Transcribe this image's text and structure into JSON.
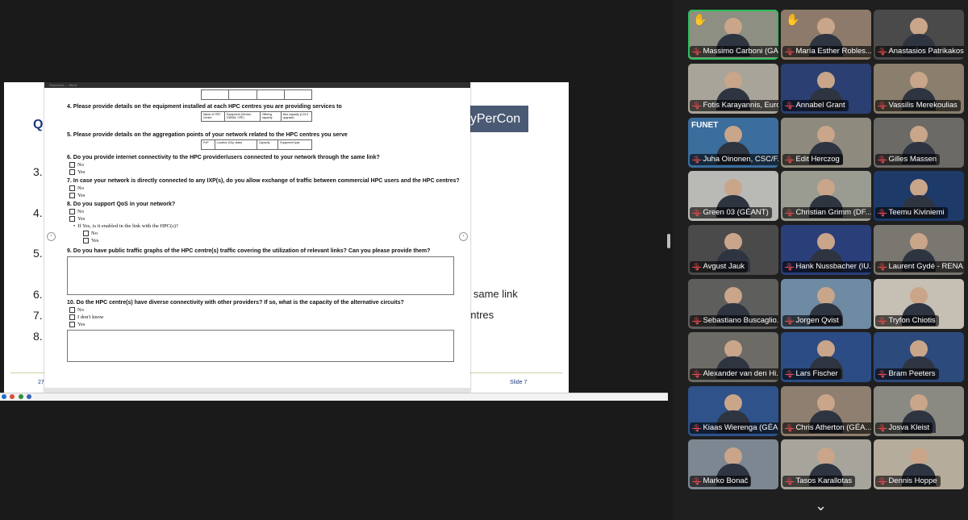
{
  "slide": {
    "heading_letter": "Q",
    "badge": "yPerCon",
    "left_numbers": [
      "3.",
      "4.",
      "5.",
      "6.",
      "7.",
      "8."
    ],
    "right_fragments": [
      "e same link",
      "entres"
    ],
    "footer_left": "27",
    "footer_right": "Slide 7"
  },
  "document": {
    "title_bar": "Document — Word",
    "q4": "4. Please provide details on the equipment installed at each HPC centres you are providing services to",
    "q4_table_headers": [
      "Name of HPC Centre",
      "Equipment (Vendor, DWDM, CPE)",
      "Offering capacity",
      "Max capacity (L2/L3 upgrade)"
    ],
    "q5": "5. Please provide details on the aggregation points of your network related to the HPC centres you serve",
    "q5_table_headers": [
      "PoP",
      "Location (City, state)",
      "Capacity",
      "Equipment type"
    ],
    "q6": "6. Do you provide internet connectivity to the HPC provider/users connected to your network through the same link?",
    "q6_options": [
      "No",
      "Yes"
    ],
    "q7": "7. In case your network is directly connected to any IXP(s), do you allow exchange of traffic between commercial HPC users and the HPC centres?",
    "q7_options": [
      "No",
      "Yes"
    ],
    "q8": "8. Do you support QoS in your network?",
    "q8_options": [
      "No",
      "Yes"
    ],
    "q8_sub": "If Yes, is it enabled in the link with the HPC(s)?",
    "q8_sub_options": [
      "No",
      "Yes"
    ],
    "q9": "9. Do you have public traffic graphs of the HPC centre(s) traffic covering the utilization of relevant links? Can you please provide them?",
    "q10": "10. Do the HPC centre(s) have diverse connectivity with other providers? If so, what is the capacity of the alternative circuits?",
    "q10_options": [
      "No",
      "I don't know",
      "Yes"
    ]
  },
  "participants": [
    {
      "name": "Massimo Carboni (GARR)",
      "raised_hand": true,
      "active": true,
      "bg": "#8c8f82"
    },
    {
      "name": "María Esther Robles...",
      "raised_hand": true,
      "active": false,
      "bg": "#8d7a6a"
    },
    {
      "name": "Anastasios Patrikakos",
      "raised_hand": false,
      "active": false,
      "bg": "#4a4a4a"
    },
    {
      "name": "Fotis Karayannis, EuroH...",
      "raised_hand": false,
      "active": false,
      "bg": "#a9a49a"
    },
    {
      "name": "Annabel Grant",
      "raised_hand": false,
      "active": false,
      "bg": "#2b3f73"
    },
    {
      "name": "Vassilis Merekoulias",
      "raised_hand": false,
      "active": false,
      "bg": "#8a7e6c"
    },
    {
      "name": "Juha Oinonen, CSC/F...",
      "raised_hand": false,
      "active": false,
      "bg": "#3b6d9d",
      "brand": "FUNET"
    },
    {
      "name": "Edit Herczog",
      "raised_hand": false,
      "active": false,
      "bg": "#8e8a7d"
    },
    {
      "name": "Gilles Massen",
      "raised_hand": false,
      "active": false,
      "bg": "#6b6a66"
    },
    {
      "name": "Green 03  (GÉANT)",
      "raised_hand": false,
      "active": false,
      "bg": "#b9b9b5"
    },
    {
      "name": "Christian Grimm (DF...",
      "raised_hand": false,
      "active": false,
      "bg": "#9a9c92"
    },
    {
      "name": "Teemu Kiviniemi",
      "raised_hand": false,
      "active": false,
      "bg": "#1d3a69"
    },
    {
      "name": "Avgust Jauk",
      "raised_hand": false,
      "active": false,
      "bg": "#4a4a4a"
    },
    {
      "name": "Hank Nussbacher (IU...",
      "raised_hand": false,
      "active": false,
      "bg": "#2a3e7a"
    },
    {
      "name": "Laurent Gydé - RENA...",
      "raised_hand": false,
      "active": false,
      "bg": "#7a7670"
    },
    {
      "name": "Sebastiano Buscaglio...",
      "raised_hand": false,
      "active": false,
      "bg": "#5e5e5c"
    },
    {
      "name": "Jorgen Qvist",
      "raised_hand": false,
      "active": false,
      "bg": "#6f8aa3"
    },
    {
      "name": "Tryfon Chiotis",
      "raised_hand": false,
      "active": false,
      "bg": "#c6c0b4"
    },
    {
      "name": "Alexander van den Hi...",
      "raised_hand": false,
      "active": false,
      "bg": "#6c6b66"
    },
    {
      "name": "Lars Fischer",
      "raised_hand": false,
      "active": false,
      "bg": "#2c4c85"
    },
    {
      "name": "Bram Peeters",
      "raised_hand": false,
      "active": false,
      "bg": "#2d4a7d"
    },
    {
      "name": "Kiaas Wierenga (GÉA...",
      "raised_hand": false,
      "active": false,
      "bg": "#2e5289"
    },
    {
      "name": "Chris Atherton (GÉA...",
      "raised_hand": false,
      "active": false,
      "bg": "#8e7f70"
    },
    {
      "name": "Josva Kleist",
      "raised_hand": false,
      "active": false,
      "bg": "#8a8a82"
    },
    {
      "name": "Marko Bonač",
      "raised_hand": false,
      "active": false,
      "bg": "#7d8791"
    },
    {
      "name": "Tasos Karallotas",
      "raised_hand": false,
      "active": false,
      "bg": "#a7a49c"
    },
    {
      "name": "Dennis Hoppe",
      "raised_hand": false,
      "active": false,
      "bg": "#b6ac9c"
    }
  ]
}
